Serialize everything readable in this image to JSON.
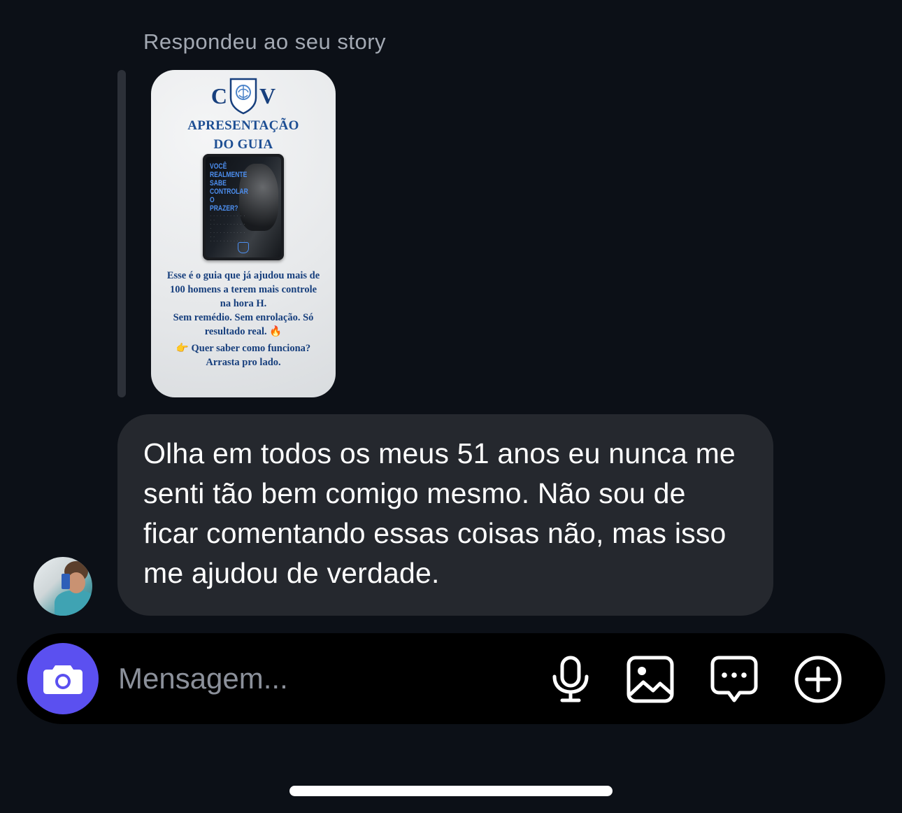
{
  "reply": {
    "label": "Respondeu ao seu story"
  },
  "story": {
    "logo_left": "C",
    "logo_right": "V",
    "headline_line1": "APRESENTAÇÃO",
    "headline_line2": "DO GUIA",
    "tablet_title": "VOCÊ REALMENTE SABE CONTROLAR O PRAZER?",
    "body_line1": "Esse é o guia que já ajudou mais de",
    "body_line2": "100 homens a terem mais controle",
    "body_line3": "na hora H.",
    "body_line4": "Sem remédio. Sem enrolação. Só",
    "body_line5": "resultado real. 🔥",
    "body_line6": "👉 Quer saber como funciona?",
    "body_line7": "Arrasta pro lado."
  },
  "message": {
    "text": "Olha em todos os meus 51 anos eu nunca me senti tão bem comigo mesmo. Não sou de ficar comentando essas coisas não, mas isso me ajudou de verdade."
  },
  "composer": {
    "placeholder": "Mensagem...",
    "accent_color": "#5b50f0",
    "icons": [
      "camera-icon",
      "microphone-icon",
      "image-icon",
      "sticker-message-icon",
      "plus-circle-icon"
    ]
  }
}
